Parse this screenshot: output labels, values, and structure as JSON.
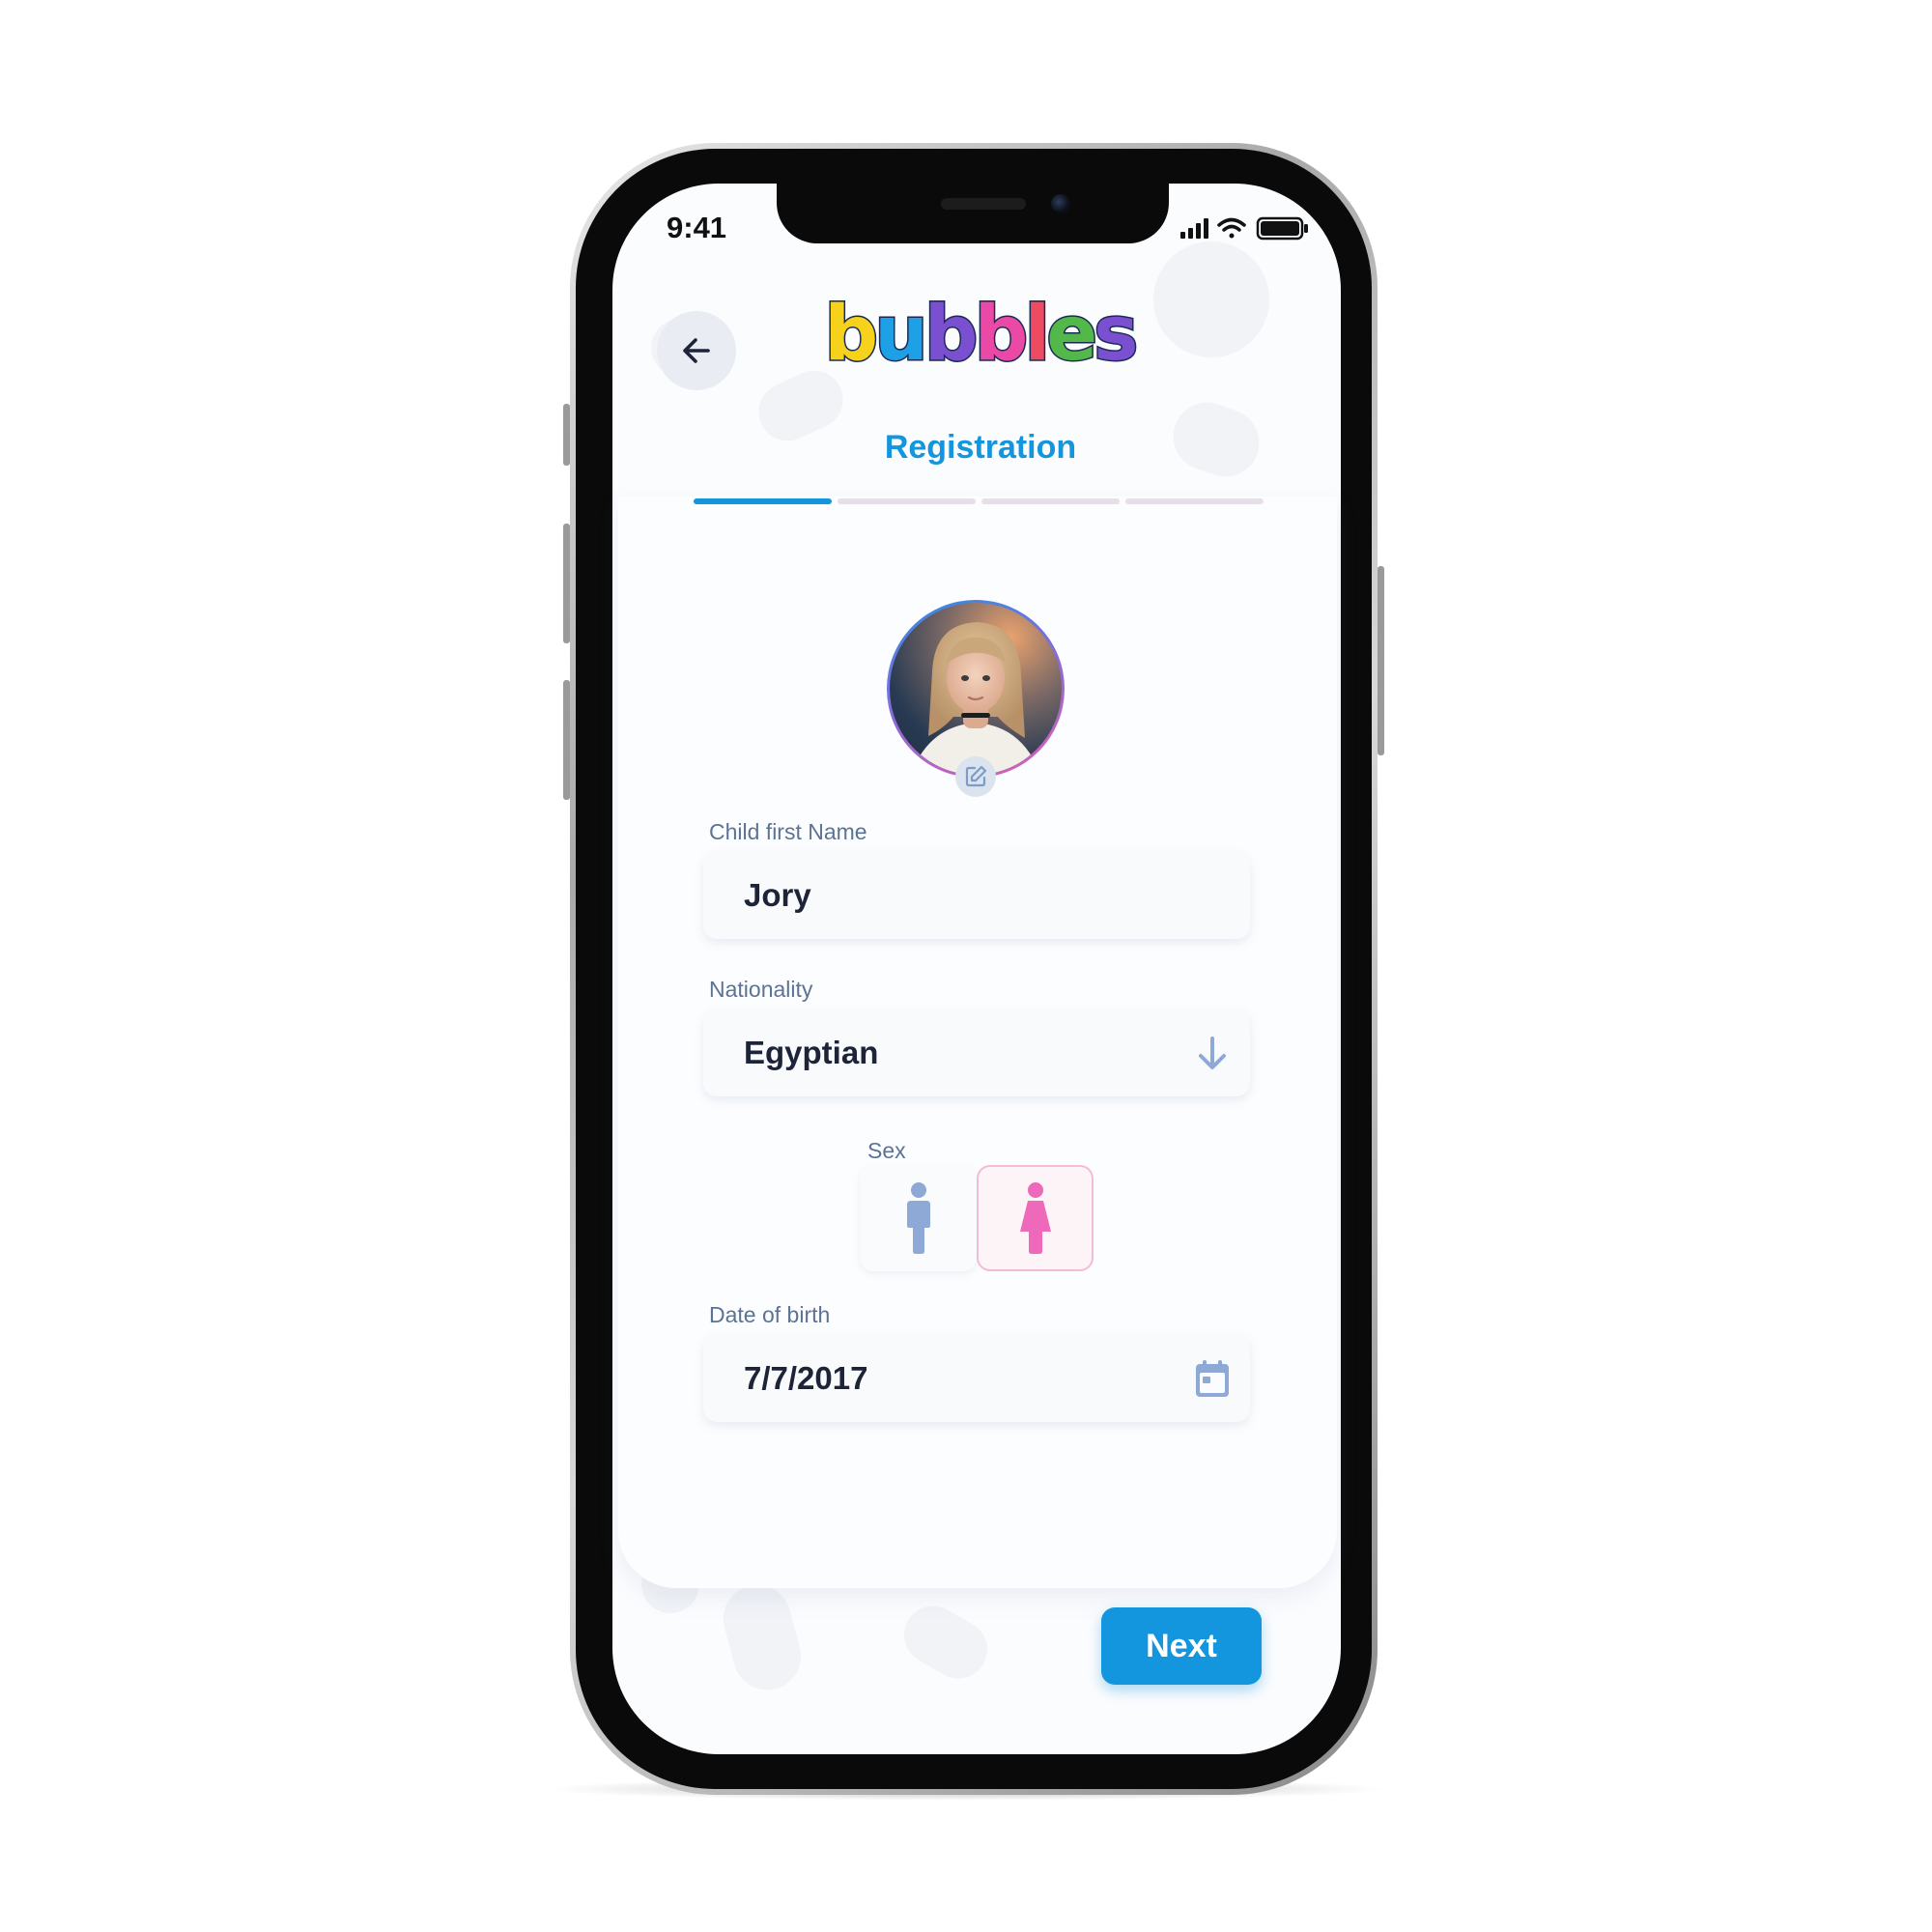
{
  "status_bar": {
    "time": "9:41",
    "icons": [
      "signal-icon",
      "wifi-icon",
      "battery-icon"
    ]
  },
  "header": {
    "back_icon": "arrow-left-icon",
    "logo_text": "bubbles",
    "title": "Registration"
  },
  "progress": {
    "total_steps": 4,
    "current_step": 1
  },
  "avatar": {
    "edit_icon": "edit-icon"
  },
  "form": {
    "first_name": {
      "label": "Child first Name",
      "value": "Jory"
    },
    "nationality": {
      "label": "Nationality",
      "value": "Egyptian",
      "icon": "arrow-down-icon"
    },
    "sex": {
      "label": "Sex",
      "options": [
        "male",
        "female"
      ],
      "selected": "female"
    },
    "date_of_birth": {
      "label": "Date of birth",
      "value": "7/7/2017",
      "icon": "calendar-icon"
    }
  },
  "actions": {
    "next_label": "Next"
  },
  "colors": {
    "accent": "#1396dd",
    "male": "#8fa9d6",
    "female": "#ee69b9",
    "label": "#5d7394",
    "value": "#1d2438"
  }
}
